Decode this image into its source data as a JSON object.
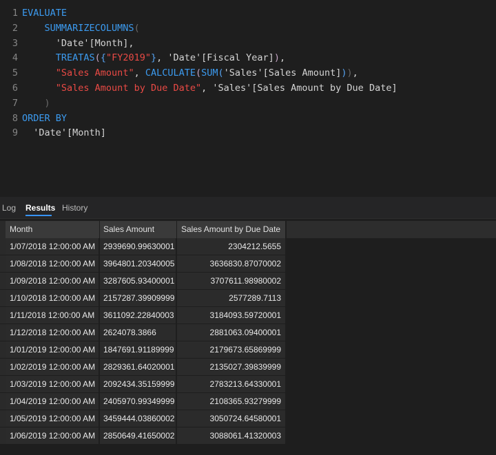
{
  "editor": {
    "lines": [
      {
        "num": "1",
        "tokens": [
          {
            "t": "EVALUATE",
            "c": "kw"
          }
        ]
      },
      {
        "num": "2",
        "tokens": [
          {
            "t": "    SUMMARIZECOLUMNS",
            "c": "kw"
          },
          {
            "t": "(",
            "c": "faint"
          }
        ]
      },
      {
        "num": "3",
        "tokens": [
          {
            "t": "      'Date'[Month],",
            "c": "ident"
          }
        ]
      },
      {
        "num": "4",
        "tokens": [
          {
            "t": "      TREATAS",
            "c": "kw"
          },
          {
            "t": "(",
            "c": "paren1"
          },
          {
            "t": "{",
            "c": "bracket2"
          },
          {
            "t": "\"FY2019\"",
            "c": "str"
          },
          {
            "t": "}",
            "c": "bracket2"
          },
          {
            "t": ", 'Date'[Fiscal Year]",
            "c": "ident"
          },
          {
            "t": ")",
            "c": "paren1"
          },
          {
            "t": ",",
            "c": "ident"
          }
        ]
      },
      {
        "num": "5",
        "tokens": [
          {
            "t": "      ",
            "c": "ident"
          },
          {
            "t": "\"Sales Amount\"",
            "c": "str"
          },
          {
            "t": ", ",
            "c": "ident"
          },
          {
            "t": "CALCULATE",
            "c": "kw"
          },
          {
            "t": "(",
            "c": "paren1"
          },
          {
            "t": "SUM",
            "c": "kw"
          },
          {
            "t": "(",
            "c": "bracket2"
          },
          {
            "t": "'Sales'[Sales Amount]",
            "c": "ident"
          },
          {
            "t": ")",
            "c": "bracket2"
          },
          {
            "t": ")",
            "c": "faint"
          },
          {
            "t": ",",
            "c": "ident"
          }
        ]
      },
      {
        "num": "6",
        "tokens": [
          {
            "t": "      ",
            "c": "ident"
          },
          {
            "t": "\"Sales Amount by Due Date\"",
            "c": "str"
          },
          {
            "t": ", 'Sales'[Sales Amount by Due Date]",
            "c": "ident"
          }
        ]
      },
      {
        "num": "7",
        "tokens": [
          {
            "t": "    )",
            "c": "faint"
          }
        ]
      },
      {
        "num": "8",
        "tokens": [
          {
            "t": "ORDER BY",
            "c": "kw"
          }
        ]
      },
      {
        "num": "9",
        "tokens": [
          {
            "t": "  'Date'[Month]",
            "c": "ident"
          }
        ]
      }
    ]
  },
  "tabs": [
    {
      "label": "Log",
      "active": false
    },
    {
      "label": "Results",
      "active": true
    },
    {
      "label": "History",
      "active": false
    }
  ],
  "grid": {
    "columns": [
      "Month",
      "Sales Amount",
      "Sales Amount by Due Date"
    ],
    "rows": [
      [
        "1/07/2018 12:00:00 AM",
        "2939690.99630001",
        "2304212.5655"
      ],
      [
        "1/08/2018 12:00:00 AM",
        "3964801.20340005",
        "3636830.87070002"
      ],
      [
        "1/09/2018 12:00:00 AM",
        "3287605.93400001",
        "3707611.98980002"
      ],
      [
        "1/10/2018 12:00:00 AM",
        "2157287.39909999",
        "2577289.7113"
      ],
      [
        "1/11/2018 12:00:00 AM",
        "3611092.22840003",
        "3184093.59720001"
      ],
      [
        "1/12/2018 12:00:00 AM",
        "2624078.3866",
        "2881063.09400001"
      ],
      [
        "1/01/2019 12:00:00 AM",
        "1847691.91189999",
        "2179673.65869999"
      ],
      [
        "1/02/2019 12:00:00 AM",
        "2829361.64020001",
        "2135027.39839999"
      ],
      [
        "1/03/2019 12:00:00 AM",
        "2092434.35159999",
        "2783213.64330001"
      ],
      [
        "1/04/2019 12:00:00 AM",
        "2405970.99349999",
        "2108365.93279999"
      ],
      [
        "1/05/2019 12:00:00 AM",
        "3459444.03860002",
        "3050724.64580001"
      ],
      [
        "1/06/2019 12:00:00 AM",
        "2850649.41650002",
        "3088061.41320003"
      ]
    ]
  },
  "colors": {
    "keyword": "#3c9bf0",
    "string": "#ea4a45",
    "text": "#d4d4d4",
    "accent": "#3794ff"
  }
}
